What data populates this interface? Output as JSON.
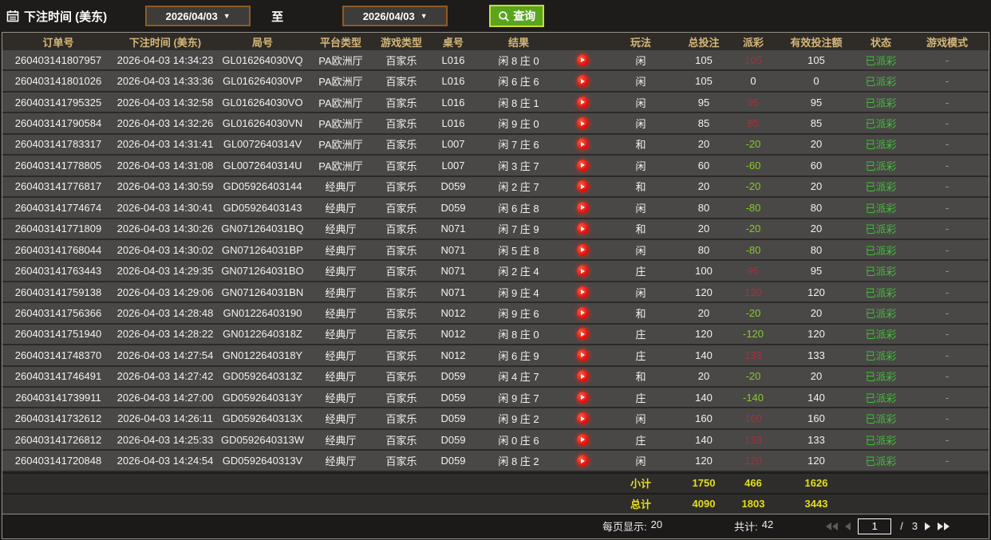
{
  "topbar": {
    "title": "下注时间 (美东)",
    "date_from": "2026/04/03",
    "date_to": "2026/04/03",
    "to_label": "至",
    "search_label": "查询"
  },
  "table": {
    "headers": {
      "order": "订单号",
      "time": "下注时间 (美东)",
      "round": "局号",
      "platform": "平台类型",
      "game": "游戏类型",
      "table_no": "桌号",
      "result": "结果",
      "play": "玩法",
      "total": "总投注",
      "payout": "派彩",
      "valid": "有效投注额",
      "status": "状态",
      "mode": "游戏模式"
    },
    "rows": [
      {
        "order": "260403141807957",
        "time": "2026-04-03 14:34:23",
        "round": "GL016264030VQ",
        "platform": "PA欧洲厅",
        "game": "百家乐",
        "table": "L016",
        "result": "闲 8 庄 0",
        "play": "闲",
        "total": "105",
        "payout": "105",
        "payout_sign": "pos",
        "valid": "105",
        "status": "已派彩",
        "mode": "-"
      },
      {
        "order": "260403141801026",
        "time": "2026-04-03 14:33:36",
        "round": "GL016264030VP",
        "platform": "PA欧洲厅",
        "game": "百家乐",
        "table": "L016",
        "result": "闲 6 庄 6",
        "play": "闲",
        "total": "105",
        "payout": "0",
        "payout_sign": "zero",
        "valid": "0",
        "status": "已派彩",
        "mode": "-"
      },
      {
        "order": "260403141795325",
        "time": "2026-04-03 14:32:58",
        "round": "GL016264030VO",
        "platform": "PA欧洲厅",
        "game": "百家乐",
        "table": "L016",
        "result": "闲 8 庄 1",
        "play": "闲",
        "total": "95",
        "payout": "95",
        "payout_sign": "pos",
        "valid": "95",
        "status": "已派彩",
        "mode": "-"
      },
      {
        "order": "260403141790584",
        "time": "2026-04-03 14:32:26",
        "round": "GL016264030VN",
        "platform": "PA欧洲厅",
        "game": "百家乐",
        "table": "L016",
        "result": "闲 9 庄 0",
        "play": "闲",
        "total": "85",
        "payout": "85",
        "payout_sign": "pos",
        "valid": "85",
        "status": "已派彩",
        "mode": "-"
      },
      {
        "order": "260403141783317",
        "time": "2026-04-03 14:31:41",
        "round": "GL0072640314V",
        "platform": "PA欧洲厅",
        "game": "百家乐",
        "table": "L007",
        "result": "闲 7 庄 6",
        "play": "和",
        "total": "20",
        "payout": "-20",
        "payout_sign": "neg",
        "valid": "20",
        "status": "已派彩",
        "mode": "-"
      },
      {
        "order": "260403141778805",
        "time": "2026-04-03 14:31:08",
        "round": "GL0072640314U",
        "platform": "PA欧洲厅",
        "game": "百家乐",
        "table": "L007",
        "result": "闲 3 庄 7",
        "play": "闲",
        "total": "60",
        "payout": "-60",
        "payout_sign": "neg",
        "valid": "60",
        "status": "已派彩",
        "mode": "-"
      },
      {
        "order": "260403141776817",
        "time": "2026-04-03 14:30:59",
        "round": "GD05926403144",
        "platform": "经典厅",
        "game": "百家乐",
        "table": "D059",
        "result": "闲 2 庄 7",
        "play": "和",
        "total": "20",
        "payout": "-20",
        "payout_sign": "neg",
        "valid": "20",
        "status": "已派彩",
        "mode": "-"
      },
      {
        "order": "260403141774674",
        "time": "2026-04-03 14:30:41",
        "round": "GD05926403143",
        "platform": "经典厅",
        "game": "百家乐",
        "table": "D059",
        "result": "闲 6 庄 8",
        "play": "闲",
        "total": "80",
        "payout": "-80",
        "payout_sign": "neg",
        "valid": "80",
        "status": "已派彩",
        "mode": "-"
      },
      {
        "order": "260403141771809",
        "time": "2026-04-03 14:30:26",
        "round": "GN071264031BQ",
        "platform": "经典厅",
        "game": "百家乐",
        "table": "N071",
        "result": "闲 7 庄 9",
        "play": "和",
        "total": "20",
        "payout": "-20",
        "payout_sign": "neg",
        "valid": "20",
        "status": "已派彩",
        "mode": "-"
      },
      {
        "order": "260403141768044",
        "time": "2026-04-03 14:30:02",
        "round": "GN071264031BP",
        "platform": "经典厅",
        "game": "百家乐",
        "table": "N071",
        "result": "闲 5 庄 8",
        "play": "闲",
        "total": "80",
        "payout": "-80",
        "payout_sign": "neg",
        "valid": "80",
        "status": "已派彩",
        "mode": "-"
      },
      {
        "order": "260403141763443",
        "time": "2026-04-03 14:29:35",
        "round": "GN071264031BO",
        "platform": "经典厅",
        "game": "百家乐",
        "table": "N071",
        "result": "闲 2 庄 4",
        "play": "庄",
        "total": "100",
        "payout": "95",
        "payout_sign": "pos",
        "valid": "95",
        "status": "已派彩",
        "mode": "-"
      },
      {
        "order": "260403141759138",
        "time": "2026-04-03 14:29:06",
        "round": "GN071264031BN",
        "platform": "经典厅",
        "game": "百家乐",
        "table": "N071",
        "result": "闲 9 庄 4",
        "play": "闲",
        "total": "120",
        "payout": "120",
        "payout_sign": "pos",
        "valid": "120",
        "status": "已派彩",
        "mode": "-"
      },
      {
        "order": "260403141756366",
        "time": "2026-04-03 14:28:48",
        "round": "GN01226403190",
        "platform": "经典厅",
        "game": "百家乐",
        "table": "N012",
        "result": "闲 9 庄 6",
        "play": "和",
        "total": "20",
        "payout": "-20",
        "payout_sign": "neg",
        "valid": "20",
        "status": "已派彩",
        "mode": "-"
      },
      {
        "order": "260403141751940",
        "time": "2026-04-03 14:28:22",
        "round": "GN0122640318Z",
        "platform": "经典厅",
        "game": "百家乐",
        "table": "N012",
        "result": "闲 8 庄 0",
        "play": "庄",
        "total": "120",
        "payout": "-120",
        "payout_sign": "neg",
        "valid": "120",
        "status": "已派彩",
        "mode": "-"
      },
      {
        "order": "260403141748370",
        "time": "2026-04-03 14:27:54",
        "round": "GN0122640318Y",
        "platform": "经典厅",
        "game": "百家乐",
        "table": "N012",
        "result": "闲 6 庄 9",
        "play": "庄",
        "total": "140",
        "payout": "133",
        "payout_sign": "pos",
        "valid": "133",
        "status": "已派彩",
        "mode": "-"
      },
      {
        "order": "260403141746491",
        "time": "2026-04-03 14:27:42",
        "round": "GD0592640313Z",
        "platform": "经典厅",
        "game": "百家乐",
        "table": "D059",
        "result": "闲 4 庄 7",
        "play": "和",
        "total": "20",
        "payout": "-20",
        "payout_sign": "neg",
        "valid": "20",
        "status": "已派彩",
        "mode": "-"
      },
      {
        "order": "260403141739911",
        "time": "2026-04-03 14:27:00",
        "round": "GD0592640313Y",
        "platform": "经典厅",
        "game": "百家乐",
        "table": "D059",
        "result": "闲 9 庄 7",
        "play": "庄",
        "total": "140",
        "payout": "-140",
        "payout_sign": "neg",
        "valid": "140",
        "status": "已派彩",
        "mode": "-"
      },
      {
        "order": "260403141732612",
        "time": "2026-04-03 14:26:11",
        "round": "GD0592640313X",
        "platform": "经典厅",
        "game": "百家乐",
        "table": "D059",
        "result": "闲 9 庄 2",
        "play": "闲",
        "total": "160",
        "payout": "160",
        "payout_sign": "pos",
        "valid": "160",
        "status": "已派彩",
        "mode": "-"
      },
      {
        "order": "260403141726812",
        "time": "2026-04-03 14:25:33",
        "round": "GD0592640313W",
        "platform": "经典厅",
        "game": "百家乐",
        "table": "D059",
        "result": "闲 0 庄 6",
        "play": "庄",
        "total": "140",
        "payout": "133",
        "payout_sign": "pos",
        "valid": "133",
        "status": "已派彩",
        "mode": "-"
      },
      {
        "order": "260403141720848",
        "time": "2026-04-03 14:24:54",
        "round": "GD0592640313V",
        "platform": "经典厅",
        "game": "百家乐",
        "table": "D059",
        "result": "闲 8 庄 2",
        "play": "闲",
        "total": "120",
        "payout": "120",
        "payout_sign": "pos",
        "valid": "120",
        "status": "已派彩",
        "mode": "-"
      }
    ],
    "subtotal": {
      "label": "小计",
      "total": "1750",
      "payout": "466",
      "valid": "1626"
    },
    "grandtotal": {
      "label": "总计",
      "total": "4090",
      "payout": "1803",
      "valid": "3443"
    }
  },
  "footer": {
    "per_page_label": "每页显示:",
    "per_page_value": "20",
    "total_count_label": "共计:",
    "total_count_value": "42",
    "page": "1",
    "page_sep": "/",
    "page_count": "3"
  },
  "colors": {
    "accent_green": "#5aa51e",
    "header_gold": "#d4b67a",
    "win_red": "#a7303c",
    "loss_green": "#8cc82e",
    "total_yellow": "#e3df1e",
    "status_green": "#3fbf35"
  }
}
